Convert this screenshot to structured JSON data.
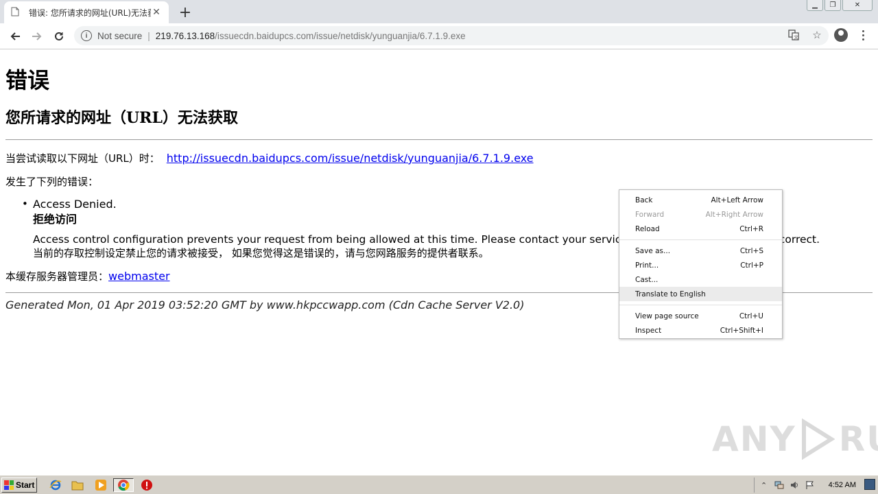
{
  "browser": {
    "tab_title": "错误: 您所请求的网址(URL)无法获取",
    "tab_close": "✕",
    "new_tab": "+",
    "security_label": "Not secure",
    "url_host": "219.76.13.168",
    "url_path": "/issuecdn.baidupcs.com/issue/netdisk/yunguanjia/6.7.1.9.exe"
  },
  "page": {
    "heading": "错误",
    "subheading": "您所请求的网址（URL）无法获取",
    "attempt_label": "当尝试读取以下网址（URL）时：",
    "attempt_url": "http://issuecdn.baidupcs.com/issue/netdisk/yunguanjia/6.7.1.9.exe",
    "error_occurred": "发生了下列的错误：",
    "error_title_en": "Access Denied.",
    "error_title_zh": "拒绝访问",
    "error_desc_en": "Access control configuration prevents your request from being allowed at this time. Please contact your service provider if you feel this is incorrect.",
    "error_desc_zh": "当前的存取控制设定禁止您的请求被接受， 如果您觉得这是错误的，请与您网路服务的提供者联系。",
    "admin_label": "本缓存服务器管理员：",
    "admin_link": "webmaster",
    "footer": "Generated Mon, 01 Apr 2019 03:52:20 GMT by www.hkpccwapp.com (Cdn Cache Server V2.0)"
  },
  "context_menu": {
    "items": [
      {
        "label": "Back",
        "shortcut": "Alt+Left Arrow"
      },
      {
        "label": "Forward",
        "shortcut": "Alt+Right Arrow"
      },
      {
        "label": "Reload",
        "shortcut": "Ctrl+R"
      },
      {
        "label": "Save as...",
        "shortcut": "Ctrl+S"
      },
      {
        "label": "Print...",
        "shortcut": "Ctrl+P"
      },
      {
        "label": "Cast...",
        "shortcut": ""
      },
      {
        "label": "Translate to English",
        "shortcut": ""
      },
      {
        "label": "View page source",
        "shortcut": "Ctrl+U"
      },
      {
        "label": "Inspect",
        "shortcut": "Ctrl+Shift+I"
      }
    ]
  },
  "watermark": {
    "left": "ANY",
    "right": "RUN"
  },
  "taskbar": {
    "start_label": "Start",
    "clock": "4:52 AM"
  },
  "colors": {
    "link": "#0000ee",
    "tabstrip": "#dee1e6",
    "taskbar": "#d4d0c8"
  }
}
